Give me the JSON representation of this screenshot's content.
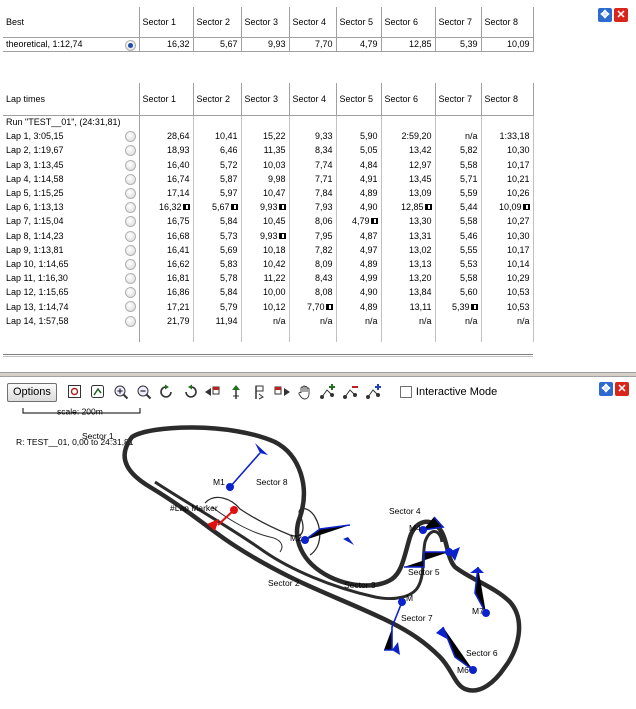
{
  "best": {
    "header_label": "Best",
    "sector_headers": [
      "Sector 1",
      "Sector 2",
      "Sector 3",
      "Sector 4",
      "Sector 5",
      "Sector 6",
      "Sector 7",
      "Sector 8"
    ],
    "theoretical": {
      "label": "theoretical, 1:12,74",
      "values": [
        "16,32",
        "5,67",
        "9,93",
        "7,70",
        "4,79",
        "12,85",
        "5,39",
        "10,09"
      ]
    }
  },
  "laps": {
    "header_label": "Lap times",
    "sector_headers": [
      "Sector 1",
      "Sector 2",
      "Sector 3",
      "Sector 4",
      "Sector 5",
      "Sector 6",
      "Sector 7",
      "Sector 8"
    ],
    "run_label": "Run \"TEST__01\", (24:31,81)",
    "rows": [
      {
        "label": "Lap 1, 3:05,15",
        "values": [
          "28,64",
          "10,41",
          "15,22",
          "9,33",
          "5,90",
          "2:59,20",
          "n/a",
          "1:33,18"
        ]
      },
      {
        "label": "Lap 2, 1:19,67",
        "values": [
          "18,93",
          "6,46",
          "11,35",
          "8,34",
          "5,05",
          "13,42",
          "5,82",
          "10,30"
        ]
      },
      {
        "label": "Lap 3, 1:13,45",
        "values": [
          "16,40",
          "5,72",
          "10,03",
          "7,74",
          "4,84",
          "12,97",
          "5,58",
          "10,17"
        ]
      },
      {
        "label": "Lap 4, 1:14,58",
        "values": [
          "16,74",
          "5,87",
          "9,98",
          "7,71",
          "4,91",
          "13,45",
          "5,71",
          "10,21"
        ]
      },
      {
        "label": "Lap 5, 1:15,25",
        "values": [
          "17,14",
          "5,97",
          "10,47",
          "7,84",
          "4,89",
          "13,09",
          "5,59",
          "10,26"
        ]
      },
      {
        "label": "Lap 6, 1:13,13",
        "values": [
          "16,32",
          "5,67",
          "9,93",
          "7,93",
          "4,90",
          "12,85",
          "5,44",
          "10,09"
        ]
      },
      {
        "label": "Lap 7, 1:15,04",
        "values": [
          "16,75",
          "5,84",
          "10,45",
          "8,06",
          "4,79",
          "13,30",
          "5,58",
          "10,27"
        ]
      },
      {
        "label": "Lap 8, 1:14,23",
        "values": [
          "16,68",
          "5,73",
          "9,93",
          "7,95",
          "4,87",
          "13,31",
          "5,46",
          "10,30"
        ]
      },
      {
        "label": "Lap 9, 1:13,81",
        "values": [
          "16,41",
          "5,69",
          "10,18",
          "7,82",
          "4,97",
          "13,02",
          "5,55",
          "10,17"
        ]
      },
      {
        "label": "Lap 10, 1:14,65",
        "values": [
          "16,62",
          "5,83",
          "10,42",
          "8,09",
          "4,89",
          "13,13",
          "5,53",
          "10,14"
        ]
      },
      {
        "label": "Lap 11, 1:16,30",
        "values": [
          "16,81",
          "5,78",
          "11,22",
          "8,43",
          "4,99",
          "13,20",
          "5,58",
          "10,29"
        ]
      },
      {
        "label": "Lap 12, 1:15,65",
        "values": [
          "16,86",
          "5,84",
          "10,00",
          "8,08",
          "4,90",
          "13,84",
          "5,60",
          "10,53"
        ]
      },
      {
        "label": "Lap 13, 1:14,74",
        "values": [
          "17,21",
          "5,79",
          "10,12",
          "7,70",
          "4,89",
          "13,11",
          "5,39",
          "10,53"
        ]
      },
      {
        "label": "Lap 14, 1:57,58",
        "values": [
          "21,79",
          "11,94",
          "n/a",
          "n/a",
          "n/a",
          "n/a",
          "n/a",
          "n/a"
        ]
      }
    ]
  },
  "toolbar": {
    "options_label": "Options",
    "interactive_mode_label": "Interactive Mode",
    "tools": [
      "zoom-region-icon",
      "zoom-fit-icon",
      "zoom-in-icon",
      "zoom-out-icon",
      "rotate-ccw-icon",
      "rotate-cw-icon",
      "prev-lap-icon",
      "start-marker-icon",
      "marker-icon",
      "next-lap-icon",
      "pan-hand-icon",
      "add-marker-icon",
      "remove-marker-icon",
      "add-marker-alt-icon"
    ]
  },
  "map": {
    "scale_label": "scale: 200m",
    "run_readout": "R: TEST__01, 0,00 to 24:31,81",
    "lap_marker_label": "#Lap Marker",
    "sectors": [
      "Sector 1",
      "Sector 2",
      "Sector 3",
      "Sector 4",
      "Sector 5",
      "Sector 6",
      "Sector 7",
      "Sector 8"
    ],
    "marker_label_prefix": "M",
    "colors": {
      "track": "#2b2b2b",
      "marker": "#0b22cc",
      "lap_marker": "#e01010"
    }
  }
}
